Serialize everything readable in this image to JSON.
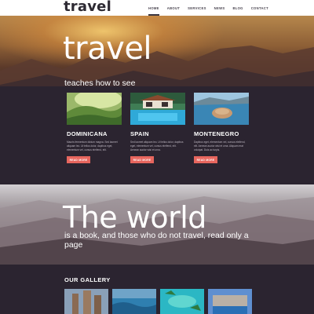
{
  "header": {
    "logo": "travel",
    "nav": [
      "HOME",
      "ABOUT",
      "SERVICES",
      "NEWS",
      "BLOG",
      "CONTACT"
    ]
  },
  "hero": {
    "title": "travel",
    "subtitle": "teaches how to see"
  },
  "destinations": [
    {
      "title": "DOMINICANA",
      "text": "Mauris fermentum dictum magna. Sed laoreet aliquam leo. Ut tellus dolor, dapibus eget, elementum vel, cursus eleifend, elit.",
      "button": "READ MORE"
    },
    {
      "title": "SPAIN",
      "text": "Sed laoreet aliquam leo. Ut tellus dolor, dapibus eget, elementum vel, cursus eleifend, elit. Aenean auctor wisi et urna.",
      "button": "READ MORE"
    },
    {
      "title": "MONTENEGRO",
      "text": "Dapibus eget, elementum vel, cursus eleifend, elit. Aenean auctor wisi et urna. Aliquam erat volutpat. Duis ac turpis.",
      "button": "READ MORE"
    }
  ],
  "world": {
    "title": "The world",
    "subtitle": "is a book, and those who do not travel, read only a page"
  },
  "gallery": {
    "title": "OUR GALLERY"
  },
  "colors": {
    "accent": "#e7665e",
    "dark_bg": "#2b2430",
    "header_bg": "#ffffff"
  }
}
